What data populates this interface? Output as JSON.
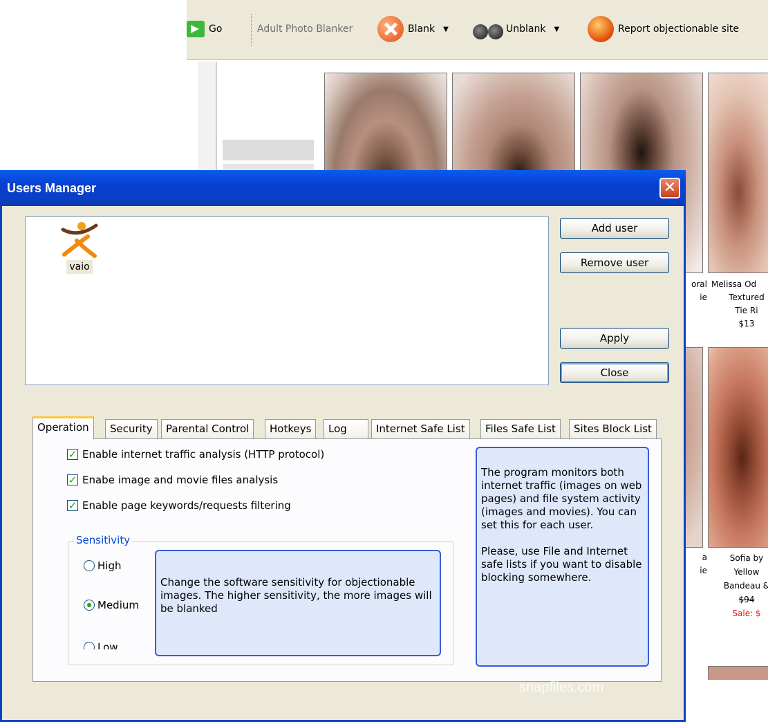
{
  "browser": {
    "go_label": "Go",
    "addon_title": "Adult Photo Blanker",
    "blank_label": "Blank",
    "unblank_label": "Unblank",
    "report_label": "Report objectionable site",
    "products": [
      {
        "line1": "oral",
        "line2": "ie"
      },
      {
        "line1": "Melissa Od",
        "line2": "Textured",
        "line3": "Tie Ri",
        "price": "$13"
      },
      {
        "line1": "a",
        "line2": "ie"
      },
      {
        "line1": "Sofia by",
        "line2": "Yellow",
        "line3": "Bandeau &",
        "price": "$94",
        "sale": "Sale: $"
      }
    ]
  },
  "dialog": {
    "title": "Users Manager",
    "close_glyph": "✕",
    "users": [
      {
        "name": "vaio"
      }
    ],
    "buttons": {
      "add_user": "Add user",
      "remove_user": "Remove user",
      "apply": "Apply",
      "close": "Close"
    },
    "tabs": [
      {
        "label": "Operation",
        "active": true
      },
      {
        "label": "Security"
      },
      {
        "label": "Parental Control"
      },
      {
        "label": "Hotkeys"
      },
      {
        "label": "Log"
      },
      {
        "label": "Internet Safe List"
      },
      {
        "label": "Files Safe List"
      },
      {
        "label": "Sites Block List"
      }
    ],
    "operation": {
      "checkboxes": [
        {
          "label": "Enable internet traffic analysis (HTTP protocol)",
          "checked": true
        },
        {
          "label": "Enabe image and movie files analysis",
          "checked": true
        },
        {
          "label": "Enable page keywords/requests filtering",
          "checked": true
        }
      ],
      "sensitivity": {
        "legend": "Sensitivity",
        "options": [
          {
            "label": "High",
            "selected": false
          },
          {
            "label": "Medium",
            "selected": true
          },
          {
            "label": "Low",
            "selected": false
          }
        ],
        "help": "Change the software sensitivity for objectionable images. The higher sensitivity, the more images will be blanked"
      },
      "info_p1": "The program monitors both internet traffic (images on web pages) and file system activity (images and movies). You can set this for each user.",
      "info_p2": "Please, use File and Internet safe lists if you want to disable blocking somewhere."
    }
  },
  "watermark": "snapfiles.com",
  "colors": {
    "titlebar": "#0a42c7",
    "dialog_bg": "#ece9d8",
    "info_box_bg": "#dfe7fb",
    "check_green": "#21a121",
    "legend_blue": "#0046d5"
  }
}
